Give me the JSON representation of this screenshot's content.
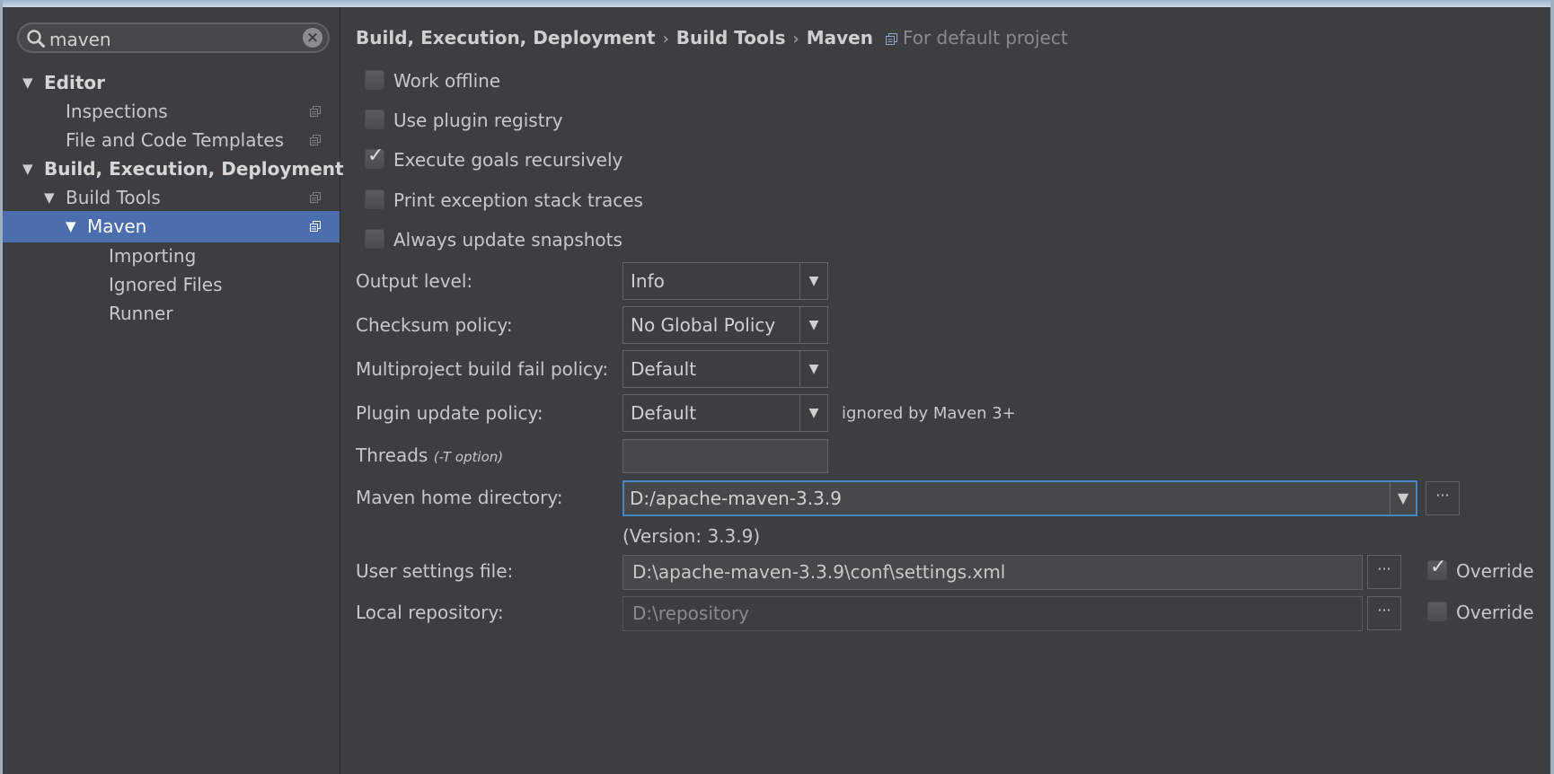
{
  "search": {
    "value": "maven"
  },
  "tree": [
    {
      "label": "Editor",
      "level": 0,
      "expanded": true,
      "bold": true
    },
    {
      "label": "Inspections",
      "level": 1,
      "project_icon": true
    },
    {
      "label": "File and Code Templates",
      "level": 1,
      "project_icon": true
    },
    {
      "label": "Build, Execution, Deployment",
      "level": 0,
      "expanded": true,
      "bold": true
    },
    {
      "label": "Build Tools",
      "level": 1,
      "expanded": true,
      "project_icon": true
    },
    {
      "label": "Maven",
      "level": 2,
      "expanded": true,
      "selected": true,
      "project_icon": true
    },
    {
      "label": "Importing",
      "level": 3
    },
    {
      "label": "Ignored Files",
      "level": 3
    },
    {
      "label": "Runner",
      "level": 3
    }
  ],
  "breadcrumb": {
    "parts": [
      "Build, Execution, Deployment",
      "Build Tools",
      "Maven"
    ],
    "separator": "›",
    "scope": "For default project"
  },
  "checkboxes": [
    {
      "label": "Work offline",
      "checked": false
    },
    {
      "label": "Use plugin registry",
      "checked": false
    },
    {
      "label": "Execute goals recursively",
      "checked": true
    },
    {
      "label": "Print exception stack traces",
      "checked": false
    },
    {
      "label": "Always update snapshots",
      "checked": false
    }
  ],
  "fields": {
    "output_level": {
      "label": "Output level:",
      "value": "Info"
    },
    "checksum_policy": {
      "label": "Checksum policy:",
      "value": "No Global Policy"
    },
    "fail_policy": {
      "label": "Multiproject build fail policy:",
      "value": "Default"
    },
    "plugin_update": {
      "label": "Plugin update policy:",
      "value": "Default",
      "note": "ignored by Maven 3+"
    },
    "threads": {
      "label": "Threads",
      "hint": "(-T option)",
      "value": ""
    },
    "maven_home": {
      "label": "Maven home directory:",
      "value": "D:/apache-maven-3.3.9",
      "version": "(Version: 3.3.9)"
    },
    "user_settings": {
      "label": "User settings file:",
      "value": "D:\\apache-maven-3.3.9\\conf\\settings.xml",
      "override_label": "Override",
      "override": true
    },
    "local_repo": {
      "label": "Local repository:",
      "value": "D:\\repository",
      "override_label": "Override",
      "override": false
    }
  },
  "browse_label": "···",
  "colors": {
    "background": "#3c3f41",
    "selection": "#4b6eaf",
    "focus_border": "#4b86c4"
  },
  "icons": {
    "search": "search-icon",
    "clear": "clear-icon",
    "project": "project-icon",
    "dropdown": "dropdown-arrow-icon"
  }
}
